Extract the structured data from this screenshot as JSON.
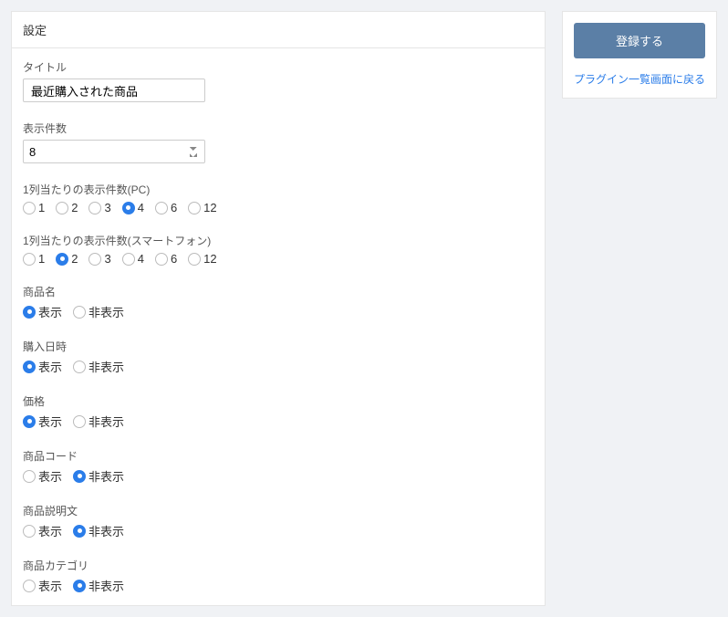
{
  "panel": {
    "title": "設定"
  },
  "fields": {
    "title": {
      "label": "タイトル",
      "value": "最近購入された商品"
    },
    "display_count": {
      "label": "表示件数",
      "value": "8"
    },
    "per_row_pc": {
      "label": "1列当たりの表示件数(PC)",
      "options": [
        "1",
        "2",
        "3",
        "4",
        "6",
        "12"
      ],
      "selected": "4"
    },
    "per_row_sp": {
      "label": "1列当たりの表示件数(スマートフォン)",
      "options": [
        "1",
        "2",
        "3",
        "4",
        "6",
        "12"
      ],
      "selected": "2"
    },
    "product_name": {
      "label": "商品名",
      "option_show": "表示",
      "option_hide": "非表示",
      "selected": "show"
    },
    "purchase_date": {
      "label": "購入日時",
      "option_show": "表示",
      "option_hide": "非表示",
      "selected": "show"
    },
    "price": {
      "label": "価格",
      "option_show": "表示",
      "option_hide": "非表示",
      "selected": "show"
    },
    "product_code": {
      "label": "商品コード",
      "option_show": "表示",
      "option_hide": "非表示",
      "selected": "hide"
    },
    "product_desc": {
      "label": "商品説明文",
      "option_show": "表示",
      "option_hide": "非表示",
      "selected": "hide"
    },
    "product_category": {
      "label": "商品カテゴリ",
      "option_show": "表示",
      "option_hide": "非表示",
      "selected": "hide"
    }
  },
  "sidebar": {
    "submit_label": "登録する",
    "back_label": "プラグイン一覧画面に戻る"
  }
}
